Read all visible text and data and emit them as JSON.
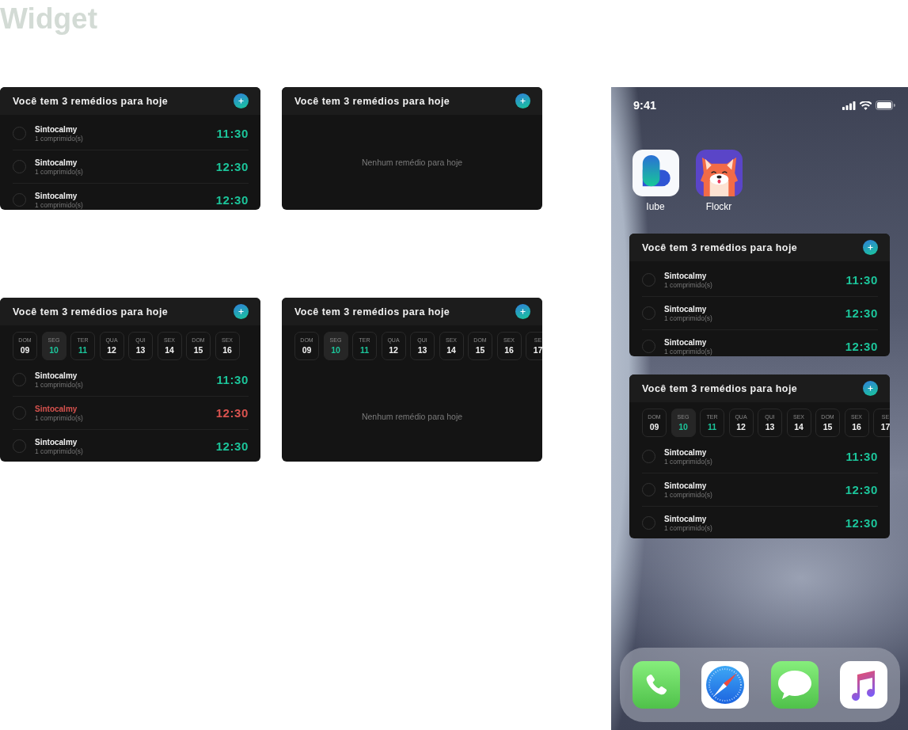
{
  "page_title": "Widget",
  "widgets": [
    {
      "title": "Você tem 3 remédios para hoje",
      "items": [
        {
          "name": "Sintocalmy",
          "dose": "1 comprimido(s)",
          "time": "11:30",
          "checked": false,
          "overdue": false
        },
        {
          "name": "Sintocalmy",
          "dose": "1 comprimido(s)",
          "time": "12:30",
          "checked": false,
          "overdue": false
        },
        {
          "name": "Sintocalmy",
          "dose": "1 comprimido(s)",
          "time": "12:30",
          "checked": false,
          "overdue": false
        }
      ]
    },
    {
      "title": "Você tem 3 remédios para hoje",
      "empty_text": "Nenhum remédio para hoje"
    },
    {
      "title": "Você tem 3 remédios para hoje",
      "days": [
        {
          "weekday": "DOM",
          "date": "09",
          "selected": false,
          "highlighted": false
        },
        {
          "weekday": "SEG",
          "date": "10",
          "selected": true,
          "highlighted": true
        },
        {
          "weekday": "TER",
          "date": "11",
          "selected": false,
          "highlighted": true
        },
        {
          "weekday": "QUA",
          "date": "12",
          "selected": false,
          "highlighted": false
        },
        {
          "weekday": "QUI",
          "date": "13",
          "selected": false,
          "highlighted": false
        },
        {
          "weekday": "SEX",
          "date": "14",
          "selected": false,
          "highlighted": false
        },
        {
          "weekday": "DOM",
          "date": "15",
          "selected": false,
          "highlighted": false
        },
        {
          "weekday": "SEX",
          "date": "16",
          "selected": false,
          "highlighted": false
        }
      ],
      "items": [
        {
          "name": "Sintocalmy",
          "dose": "1 comprimido(s)",
          "time": "11:30",
          "checked": false,
          "overdue": false
        },
        {
          "name": "Sintocalmy",
          "dose": "1 comprimido(s)",
          "time": "12:30",
          "checked": false,
          "overdue": true
        },
        {
          "name": "Sintocalmy",
          "dose": "1 comprimido(s)",
          "time": "12:30",
          "checked": false,
          "overdue": false
        }
      ]
    },
    {
      "title": "Você tem 3 remédios para hoje",
      "days": [
        {
          "weekday": "DOM",
          "date": "09",
          "selected": false,
          "highlighted": false
        },
        {
          "weekday": "SEG",
          "date": "10",
          "selected": true,
          "highlighted": true
        },
        {
          "weekday": "TER",
          "date": "11",
          "selected": false,
          "highlighted": true
        },
        {
          "weekday": "QUA",
          "date": "12",
          "selected": false,
          "highlighted": false
        },
        {
          "weekday": "QUI",
          "date": "13",
          "selected": false,
          "highlighted": false
        },
        {
          "weekday": "SEX",
          "date": "14",
          "selected": false,
          "highlighted": false
        },
        {
          "weekday": "DOM",
          "date": "15",
          "selected": false,
          "highlighted": false
        },
        {
          "weekday": "SEX",
          "date": "16",
          "selected": false,
          "highlighted": false
        },
        {
          "weekday": "SE",
          "date": "17",
          "selected": false,
          "highlighted": false
        }
      ],
      "empty_text": "Nenhum remédio para hoje"
    }
  ],
  "phone": {
    "time": "9:41",
    "apps": [
      {
        "label": "Iube",
        "kind": "iube"
      },
      {
        "label": "Flockr",
        "kind": "flockr"
      }
    ],
    "widgets": [
      {
        "title": "Você tem 3 remédios para hoje",
        "items": [
          {
            "name": "Sintocalmy",
            "dose": "1 comprimido(s)",
            "time": "11:30",
            "checked": false,
            "overdue": false
          },
          {
            "name": "Sintocalmy",
            "dose": "1 comprimido(s)",
            "time": "12:30",
            "checked": false,
            "overdue": false
          },
          {
            "name": "Sintocalmy",
            "dose": "1 comprimido(s)",
            "time": "12:30",
            "checked": false,
            "overdue": false
          }
        ]
      },
      {
        "title": "Você tem 3 remédios para hoje",
        "days": [
          {
            "weekday": "DOM",
            "date": "09",
            "selected": false,
            "highlighted": false
          },
          {
            "weekday": "SEG",
            "date": "10",
            "selected": true,
            "highlighted": true
          },
          {
            "weekday": "TER",
            "date": "11",
            "selected": false,
            "highlighted": true
          },
          {
            "weekday": "QUA",
            "date": "12",
            "selected": false,
            "highlighted": false
          },
          {
            "weekday": "QUI",
            "date": "13",
            "selected": false,
            "highlighted": false
          },
          {
            "weekday": "SEX",
            "date": "14",
            "selected": false,
            "highlighted": false
          },
          {
            "weekday": "DOM",
            "date": "15",
            "selected": false,
            "highlighted": false
          },
          {
            "weekday": "SEX",
            "date": "16",
            "selected": false,
            "highlighted": false
          },
          {
            "weekday": "SE",
            "date": "17",
            "selected": false,
            "highlighted": false
          }
        ],
        "items": [
          {
            "name": "Sintocalmy",
            "dose": "1 comprimido(s)",
            "time": "11:30",
            "checked": false,
            "overdue": false
          },
          {
            "name": "Sintocalmy",
            "dose": "1 comprimido(s)",
            "time": "12:30",
            "checked": false,
            "overdue": false
          },
          {
            "name": "Sintocalmy",
            "dose": "1 comprimido(s)",
            "time": "12:30",
            "checked": false,
            "overdue": false
          }
        ]
      }
    ],
    "dock": [
      {
        "kind": "phone"
      },
      {
        "kind": "safari"
      },
      {
        "kind": "messages"
      },
      {
        "kind": "music"
      }
    ]
  }
}
